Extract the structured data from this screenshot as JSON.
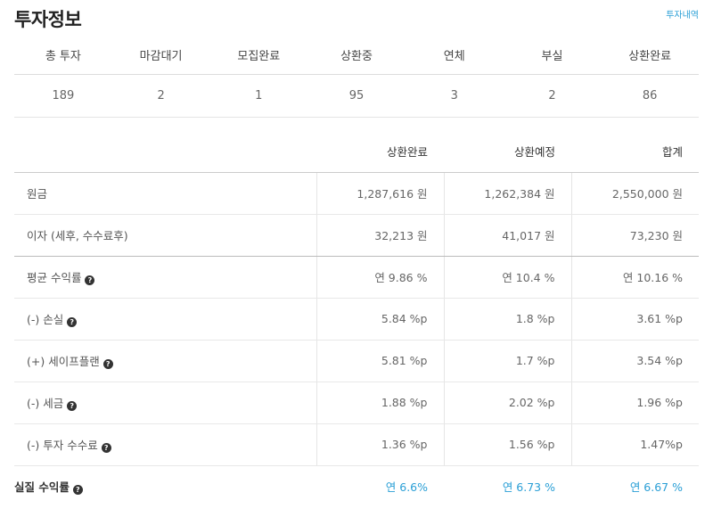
{
  "header": {
    "title": "투자정보",
    "history_link": "투자내역"
  },
  "status": {
    "columns": [
      "총 투자",
      "마감대기",
      "모집완료",
      "상환중",
      "연체",
      "부실",
      "상환완료"
    ],
    "values": [
      "189",
      "2",
      "1",
      "95",
      "3",
      "2",
      "86"
    ]
  },
  "amounts": {
    "headers": [
      "상환완료",
      "상환예정",
      "합계"
    ],
    "rows": [
      {
        "label": "원금",
        "values": [
          "1,287,616 원",
          "1,262,384 원",
          "2,550,000 원"
        ]
      },
      {
        "label": "이자 (세후, 수수료후)",
        "values": [
          "32,213 원",
          "41,017 원",
          "73,230 원"
        ]
      },
      {
        "label": "평균 수익률",
        "values": [
          "연 9.86 %",
          "연 10.4 %",
          "연 10.16 %"
        ]
      },
      {
        "label": "(-) 손실",
        "values": [
          "5.84 %p",
          "1.8 %p",
          "3.61 %p"
        ]
      },
      {
        "label": "(+) 세이프플랜",
        "values": [
          "5.81 %p",
          "1.7 %p",
          "3.54 %p"
        ]
      },
      {
        "label": "(-) 세금",
        "values": [
          "1.88 %p",
          "2.02 %p",
          "1.96 %p"
        ]
      },
      {
        "label": "(-) 투자 수수료",
        "values": [
          "1.36 %p",
          "1.56 %p",
          "1.47%p"
        ]
      }
    ],
    "total": {
      "label": "실질 수익률",
      "values": [
        "연 6.6%",
        "연 6.73 %",
        "연 6.67 %"
      ]
    },
    "help_icon": "?",
    "accent_color": "#2a9fd6"
  }
}
